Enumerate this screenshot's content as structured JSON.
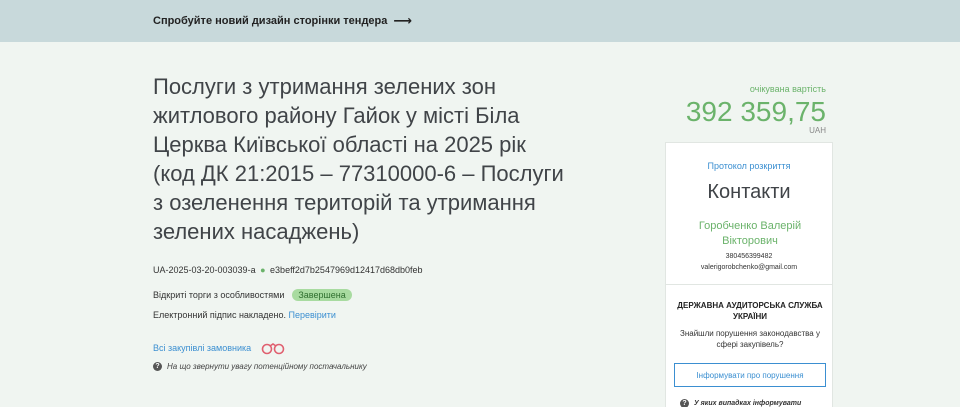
{
  "banner": {
    "text": "Спробуйте новий дизайн сторінки тендера",
    "arrow": "⟶"
  },
  "tender": {
    "title": "Послуги з утримання зелених зон житлового району Гайок у місті Біла Церква Київської області на 2025 рік (код ДК 21:2015 – 77310000-6 – Послуги з озеленення територій та утримання зелених насаджень)",
    "id": "UA-2025-03-20-003039-a",
    "hash": "e3beff2d7b2547969d12417d68db0feb",
    "dot": "●",
    "procedure": "Відкриті торги з особливостями",
    "status": "Завершена",
    "signature_text": "Електронний підпис накладено.",
    "signature_link": "Перевірити",
    "all_purchases": "Всі закупівлі замовника",
    "attention": "На що звернути увагу потенційному постачальнику"
  },
  "value": {
    "label": "очікувана вартість",
    "amount": "392 359,75",
    "currency": "UAH"
  },
  "sidebar": {
    "protocol": "Протокол розкриття",
    "contacts_title": "Контакти",
    "contact_name": "Горобченко Валерій Вікторович",
    "phone": "380456399482",
    "email": "valerigorobchenko@gmail.com",
    "agency": "ДЕРЖАВНА АУДИТОРСЬКА СЛУЖБА УКРАЇНИ",
    "violations": "Знайшли порушення законодавства у сфері закупівель?",
    "report_button": "Інформувати про порушення",
    "footnote": "У яких випадках інформувати"
  },
  "colors": {
    "accent_green": "#6bb36b",
    "link_blue": "#3b8fd1",
    "banner_bg": "#c8d9db",
    "page_bg": "#f0f5f1"
  }
}
